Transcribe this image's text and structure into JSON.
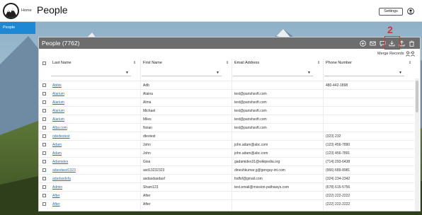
{
  "header": {
    "home_label": "Home",
    "title": "People",
    "settings_label": "Settings",
    "logo_icon": "mountain-logo-icon",
    "user_icon": "user-account-icon"
  },
  "sidebar": {
    "items": [
      {
        "label": "People",
        "active": true
      }
    ]
  },
  "panel": {
    "title": "People (7762)",
    "toolbar_icons": [
      "add-icon",
      "email-icon",
      "message-icon",
      "download-icon",
      "upload-icon",
      "delete-icon"
    ],
    "step_number": "2",
    "merge_label": "Merge Records",
    "colors": {
      "accent": "#1e88d4",
      "panel_bar": "#6d6d6d",
      "highlight": "#d9322e",
      "link": "#2a6fb8"
    }
  },
  "table": {
    "columns": [
      "Last Name",
      "First Name",
      "Email Address",
      "Phone Number"
    ],
    "rows": [
      {
        "last": "Abbts",
        "first": "Adb",
        "email": "",
        "phone": "480-442-1898"
      },
      {
        "last": "Alarium",
        "first": "Alaina",
        "email": "test@parishsoft.com",
        "phone": ""
      },
      {
        "last": "Alarium",
        "first": "Alma",
        "email": "test@parishsoft.com",
        "phone": ""
      },
      {
        "last": "Alarium",
        "first": "Michael",
        "email": "test@parishsoft.com",
        "phone": ""
      },
      {
        "last": "Alarium",
        "first": "Miles",
        "email": "test@parishsoft.com",
        "phone": ""
      },
      {
        "last": "Alba.com",
        "first": "Noian",
        "email": "test@parishsoft.com",
        "phone": ""
      },
      {
        "last": "odedestest",
        "first": "dtestest",
        "email": "",
        "phone": "(323) 232"
      },
      {
        "last": "Adam",
        "first": "John",
        "email": "john.adam@abc.com",
        "phone": "(123) 456-7890"
      },
      {
        "last": "Adam",
        "first": "John",
        "email": "john.adam@abc.com",
        "phone": "(123) 456-7891"
      },
      {
        "last": "Adamides",
        "first": "Gisa",
        "email": "gadamides31@wikipedia.org",
        "phone": "(714) 293-6438"
      },
      {
        "last": "adasdasd1323",
        "first": "asd13232323",
        "email": "dineshkumar.g@genguy-int.com",
        "phone": "(966) 689-8981"
      },
      {
        "last": "adadasdsfa",
        "first": "asdasdasdasf",
        "email": "fsdfsf@gmail.com",
        "phone": "(324) 234-2342"
      },
      {
        "last": "Admin",
        "first": "Sham123",
        "email": "test.email@mission-pathways.com",
        "phone": "(678) 615-5756"
      },
      {
        "last": "After",
        "first": "After",
        "email": "",
        "phone": "(222) 222-2222"
      },
      {
        "last": "After",
        "first": "After",
        "email": "",
        "phone": "(222) 222-2222"
      }
    ]
  }
}
